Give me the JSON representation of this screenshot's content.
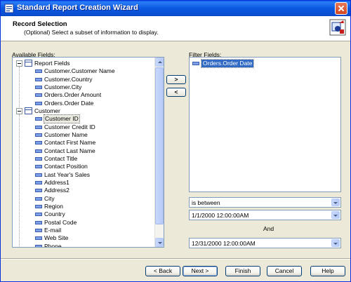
{
  "window": {
    "title": "Standard Report Creation Wizard"
  },
  "header": {
    "title": "Record Selection",
    "subtitle": "(Optional)  Select a subset of information to display."
  },
  "available": {
    "label": "Available Fields:",
    "groups": [
      {
        "name": "Report Fields",
        "fields": [
          "Customer.Customer Name",
          "Customer.Country",
          "Customer.City",
          "Orders.Order Amount",
          "Orders.Order Date"
        ]
      },
      {
        "name": "Customer",
        "fields": [
          "Customer ID",
          "Customer Credit ID",
          "Customer Name",
          "Contact First Name",
          "Contact Last Name",
          "Contact Title",
          "Contact Position",
          "Last Year's Sales",
          "Address1",
          "Address2",
          "City",
          "Region",
          "Country",
          "Postal Code",
          "E-mail",
          "Web Site",
          "Phone"
        ]
      }
    ]
  },
  "move": {
    "add_label": ">",
    "remove_label": "<"
  },
  "filter": {
    "label": "Filter Fields:",
    "fields": [
      "Orders.Order Date"
    ],
    "operator": "is between",
    "from": "1/1/2000 12:00:00AM",
    "and_label": "And",
    "to": "12/31/2000 12:00:00AM"
  },
  "buttons": {
    "back": "< Back",
    "next": "Next >",
    "finish": "Finish",
    "cancel": "Cancel",
    "help": "Help"
  },
  "icons": {
    "title": "crystal-reports-icon",
    "wizard": "wizard-filter-icon",
    "table": "table-icon",
    "field": "field-icon"
  }
}
